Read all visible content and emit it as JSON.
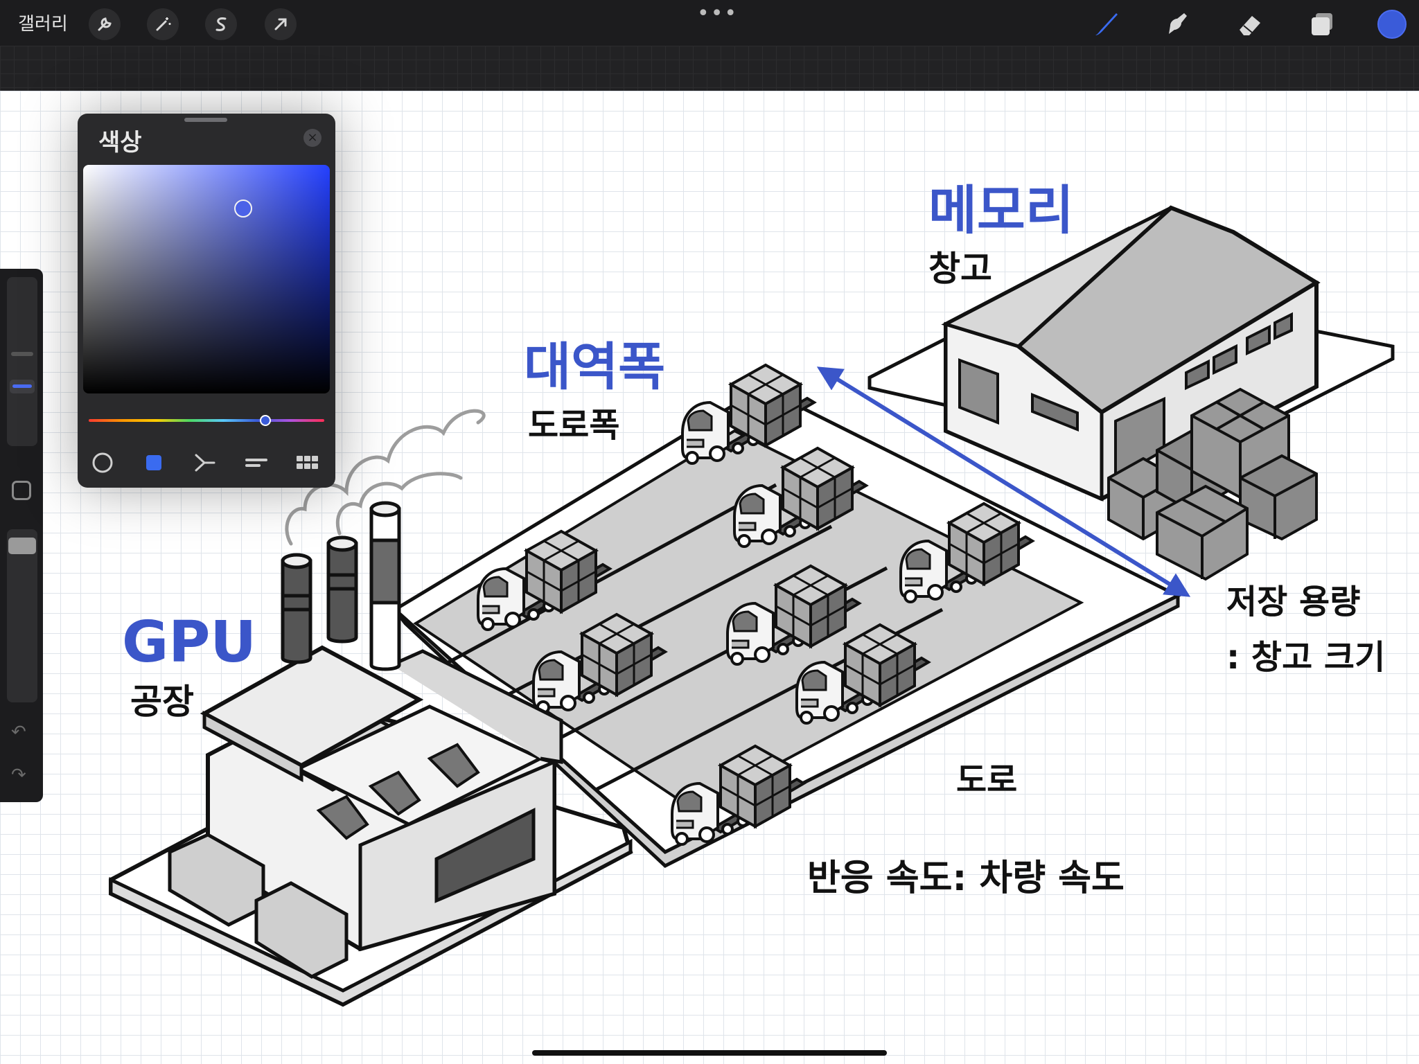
{
  "topbar": {
    "gallery_label": "갤러리",
    "left_tools": [
      "wrench-icon",
      "magic-wand-icon",
      "selection-icon",
      "transform-arrow-icon"
    ],
    "more_label": "•••",
    "right_tools": [
      "brush-icon",
      "smudge-icon",
      "eraser-icon",
      "layers-icon"
    ],
    "current_color": "#3a5bd9"
  },
  "color_panel": {
    "title": "색상",
    "selected_color": "#3a5bd9",
    "tabs": [
      "disc-tab",
      "classic-tab",
      "harmony-tab",
      "value-tab",
      "palettes-tab"
    ]
  },
  "drawing": {
    "gpu_title": "GPU",
    "gpu_sub": "공장",
    "memory_title": "메모리",
    "memory_sub": "창고",
    "bandwidth_title": "대역폭",
    "bandwidth_sub": "도로폭",
    "capacity_line1": "저장 용량",
    "capacity_line2": ": 창고 크기",
    "road_label": "도로",
    "latency_label": "반응 속도: 차량 속도"
  },
  "colors": {
    "accent_blue": "#3b56c9"
  }
}
